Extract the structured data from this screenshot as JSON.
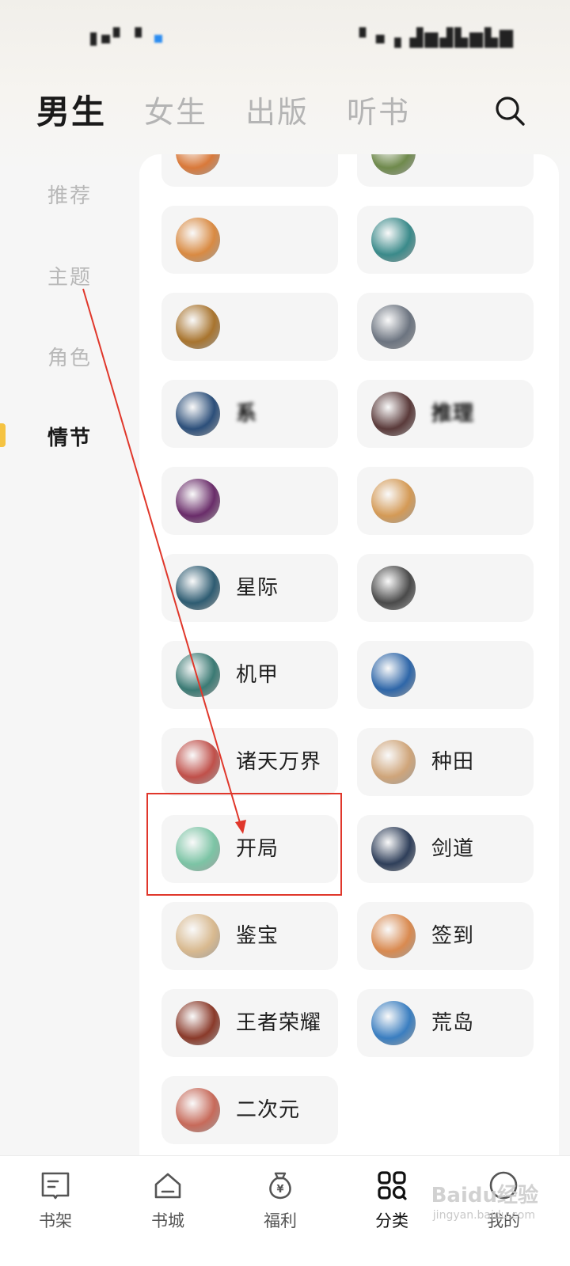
{
  "top_tabs": [
    "男生",
    "女生",
    "出版",
    "听书"
  ],
  "side_nav": [
    "推荐",
    "主题",
    "角色",
    "情节"
  ],
  "grid": [
    {
      "label": "",
      "blur": true,
      "icon": "avatar-orange-icon",
      "color": "#d9793a"
    },
    {
      "label": "",
      "blur": true,
      "icon": "avatar-green-icon",
      "color": "#6f8a4c"
    },
    {
      "label": "",
      "blur": true,
      "icon": "avatar-egg-icon",
      "color": "#d98a42"
    },
    {
      "label": "",
      "blur": true,
      "icon": "avatar-teal-icon",
      "color": "#3a8a8a"
    },
    {
      "label": "",
      "blur": true,
      "icon": "avatar-figure-icon",
      "color": "#a8742e"
    },
    {
      "label": "",
      "blur": true,
      "icon": "avatar-grey-icon",
      "color": "#6c7480"
    },
    {
      "label": "系",
      "blur": true,
      "icon": "avatar-wheel-icon",
      "color": "#2c4f7a"
    },
    {
      "label": "推理",
      "blur": true,
      "icon": "avatar-dark-icon",
      "color": "#5a3a3a"
    },
    {
      "label": "",
      "blur": true,
      "icon": "avatar-disco-icon",
      "color": "#6a2d6a"
    },
    {
      "label": "",
      "blur": true,
      "icon": "avatar-pizza-icon",
      "color": "#d49a56"
    },
    {
      "label": "星际",
      "blur": false,
      "icon": "avatar-rocket-icon",
      "color": "#2e5c72"
    },
    {
      "label": "",
      "blur": true,
      "icon": "avatar-helmet-icon",
      "color": "#4a4a4a"
    },
    {
      "label": "机甲",
      "blur": false,
      "icon": "avatar-mech-icon",
      "color": "#3b7a74"
    },
    {
      "label": "",
      "blur": true,
      "icon": "avatar-warrior-icon",
      "color": "#2e66a8"
    },
    {
      "label": "诸天万界",
      "blur": false,
      "icon": "avatar-cloud-icon",
      "color": "#c0504a"
    },
    {
      "label": "种田",
      "blur": false,
      "icon": "avatar-hoe-icon",
      "color": "#cfa57a"
    },
    {
      "label": "开局",
      "blur": false,
      "icon": "avatar-billiard-icon",
      "color": "#7cc4a5"
    },
    {
      "label": "剑道",
      "blur": false,
      "icon": "avatar-sword-icon",
      "color": "#2f3f5a"
    },
    {
      "label": "鉴宝",
      "blur": false,
      "icon": "avatar-magnifier-icon",
      "color": "#d8b98f"
    },
    {
      "label": "签到",
      "blur": false,
      "icon": "avatar-scroll-icon",
      "color": "#d98a50"
    },
    {
      "label": "王者荣耀",
      "blur": false,
      "icon": "avatar-spartan-icon",
      "color": "#8a3a2a"
    },
    {
      "label": "荒岛",
      "blur": false,
      "icon": "avatar-island-icon",
      "color": "#3a7ec0"
    },
    {
      "label": "二次元",
      "blur": false,
      "icon": "avatar-crown-icon",
      "color": "#c76a5a"
    }
  ],
  "bottom_nav": [
    {
      "label": "书架",
      "icon": "bookshelf-icon"
    },
    {
      "label": "书城",
      "icon": "home-icon"
    },
    {
      "label": "福利",
      "icon": "money-bag-icon"
    },
    {
      "label": "分类",
      "icon": "category-icon"
    },
    {
      "label": "我的",
      "icon": "profile-icon"
    }
  ],
  "watermark": {
    "brand": "Baidu经验",
    "url": "jingyan.baidu.com"
  },
  "colors": {
    "accent": "#f5c342",
    "highlight": "#e0372b",
    "cell_bg": "#f5f5f5"
  }
}
